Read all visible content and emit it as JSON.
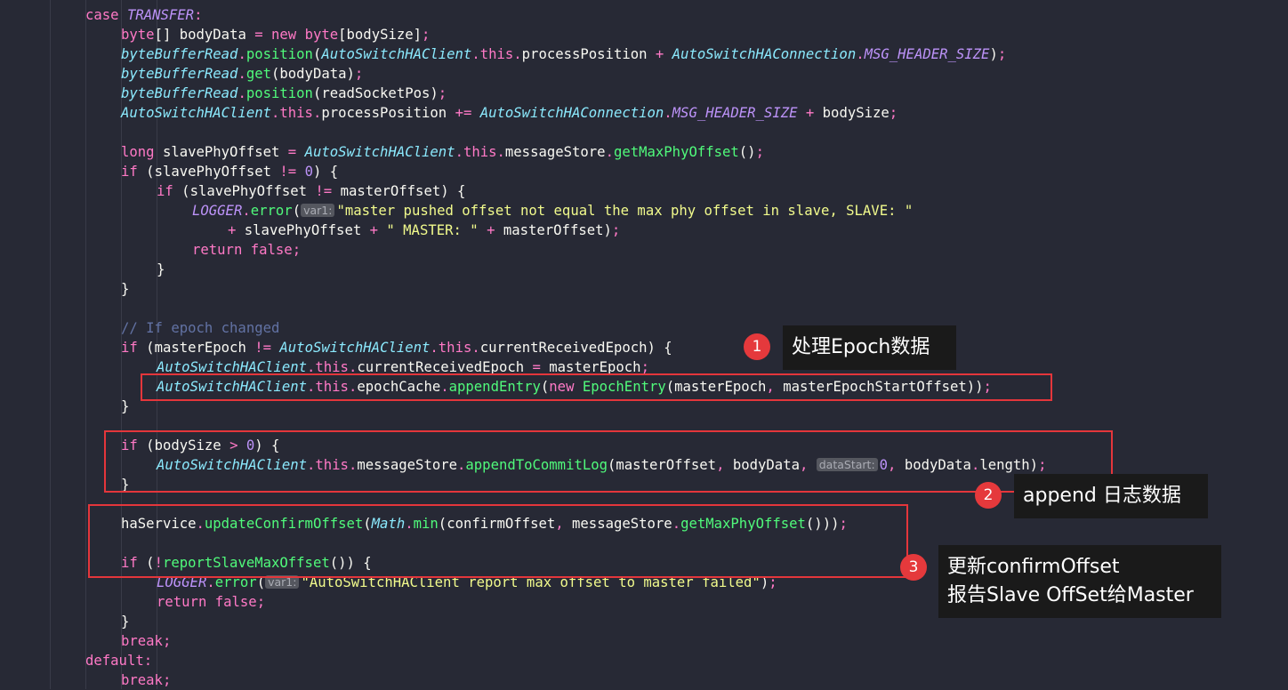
{
  "code": {
    "case_kw": "case",
    "transfer": "TRANSFER",
    "byte": "byte",
    "new": "new",
    "body_data": "bodyData",
    "body_size": "bodySize",
    "bbr": "byteBufferRead",
    "position": "position",
    "get": "get",
    "client": "AutoSwitchHAClient",
    "conn": "AutoSwitchHAConnection",
    "this": "this",
    "process_position": "processPosition",
    "header_size": "MSG_HEADER_SIZE",
    "read_socket_pos": "readSocketPos",
    "long": "long",
    "slave_offset": "slavePhyOffset",
    "message_store": "messageStore",
    "get_max": "getMaxPhyOffset",
    "if": "if",
    "zero": "0",
    "master_offset": "masterOffset",
    "logger": "LOGGER",
    "error": "error",
    "hint_var1": "var1:",
    "str_pushed": "\"master pushed offset not equal the max phy offset in slave, SLAVE: \"",
    "str_master": "\" MASTER: \"",
    "return": "return",
    "false": "false",
    "comment_epoch": "// If epoch changed",
    "master_epoch": "masterEpoch",
    "current_epoch": "currentReceivedEpoch",
    "epoch_cache": "epochCache",
    "append_entry": "appendEntry",
    "epoch_entry": "EpochEntry",
    "master_epoch_start": "masterEpochStartOffset",
    "append_commit": "appendToCommitLog",
    "hint_data_start": "dataStart:",
    "length": "length",
    "ha_service": "haService",
    "update_confirm": "updateConfirmOffset",
    "math": "Math",
    "min": "min",
    "confirm_offset": "confirmOffset",
    "report_slave": "reportSlaveMaxOffset",
    "str_report_failed": "\"AutoSwitchHAClient report max offset to master failed\"",
    "break": "break",
    "default": "default"
  },
  "annotations": [
    {
      "number": "1",
      "lines": [
        "处理Epoch数据"
      ]
    },
    {
      "number": "2",
      "lines": [
        "append 日志数据"
      ]
    },
    {
      "number": "3",
      "lines": [
        "更新confirmOffset",
        "报告Slave OffSet给Master"
      ]
    }
  ],
  "colors": {
    "background": "#272935",
    "keyword": "#ff79c6",
    "class_name": "#8be9fd",
    "field": "#bd93f9",
    "method": "#50fa7b",
    "string": "#f1fa8c",
    "comment": "#6272a4",
    "highlight_box": "#e4363b",
    "badge": "#e5393c",
    "callout_bg": "#1a1a1a"
  }
}
